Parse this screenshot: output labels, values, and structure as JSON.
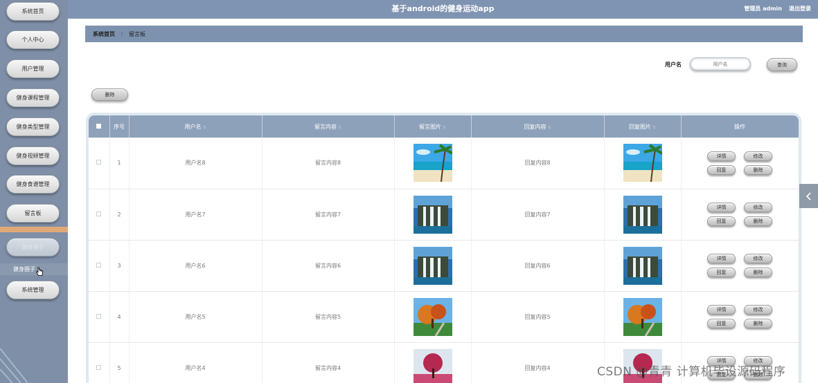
{
  "app": {
    "title": "基于android的健身运动app",
    "admin_label": "管理员 admin",
    "logout_label": "退出登录"
  },
  "sidebar": {
    "items": [
      {
        "label": "系统首页"
      },
      {
        "label": "个人中心"
      },
      {
        "label": "用户管理"
      },
      {
        "label": "健身课程管理"
      },
      {
        "label": "健身类型管理"
      },
      {
        "label": "健身视频管理"
      },
      {
        "label": "健身食谱管理"
      },
      {
        "label": "留言板"
      },
      {
        "label": "健身圈子"
      },
      {
        "label": "系统管理"
      }
    ],
    "sub_item": "健身圈子"
  },
  "breadcrumb": {
    "home": "系统首页",
    "current": "留言板"
  },
  "search": {
    "label": "用户名",
    "placeholder": "用户名",
    "button": "查询"
  },
  "toolbar": {
    "delete_label": "删除"
  },
  "table": {
    "headers": [
      "序号",
      "用户名",
      "留言内容",
      "留言图片",
      "回复内容",
      "回复图片",
      "操作"
    ],
    "rows": [
      {
        "index": "1",
        "username": "用户名8",
        "content": "留言内容8",
        "reply": "回复内容8",
        "image": "beach-icon"
      },
      {
        "index": "2",
        "username": "用户名7",
        "content": "留言内容7",
        "reply": "回复内容7",
        "image": "waterfall-icon"
      },
      {
        "index": "3",
        "username": "用户名6",
        "content": "留言内容6",
        "reply": "回复内容6",
        "image": "waterfall-icon"
      },
      {
        "index": "4",
        "username": "用户名5",
        "content": "留言内容5",
        "reply": "回复内容5",
        "image": "autumn-tree-icon"
      },
      {
        "index": "5",
        "username": "用户名4",
        "content": "留言内容4",
        "reply": "回复内容4",
        "image": "pink-tree-icon"
      }
    ],
    "actions": {
      "detail": "详情",
      "edit": "修改",
      "reply": "回复",
      "delete": "删除"
    }
  },
  "watermark": "CSDN @青青 计算机毕设源码程序"
}
